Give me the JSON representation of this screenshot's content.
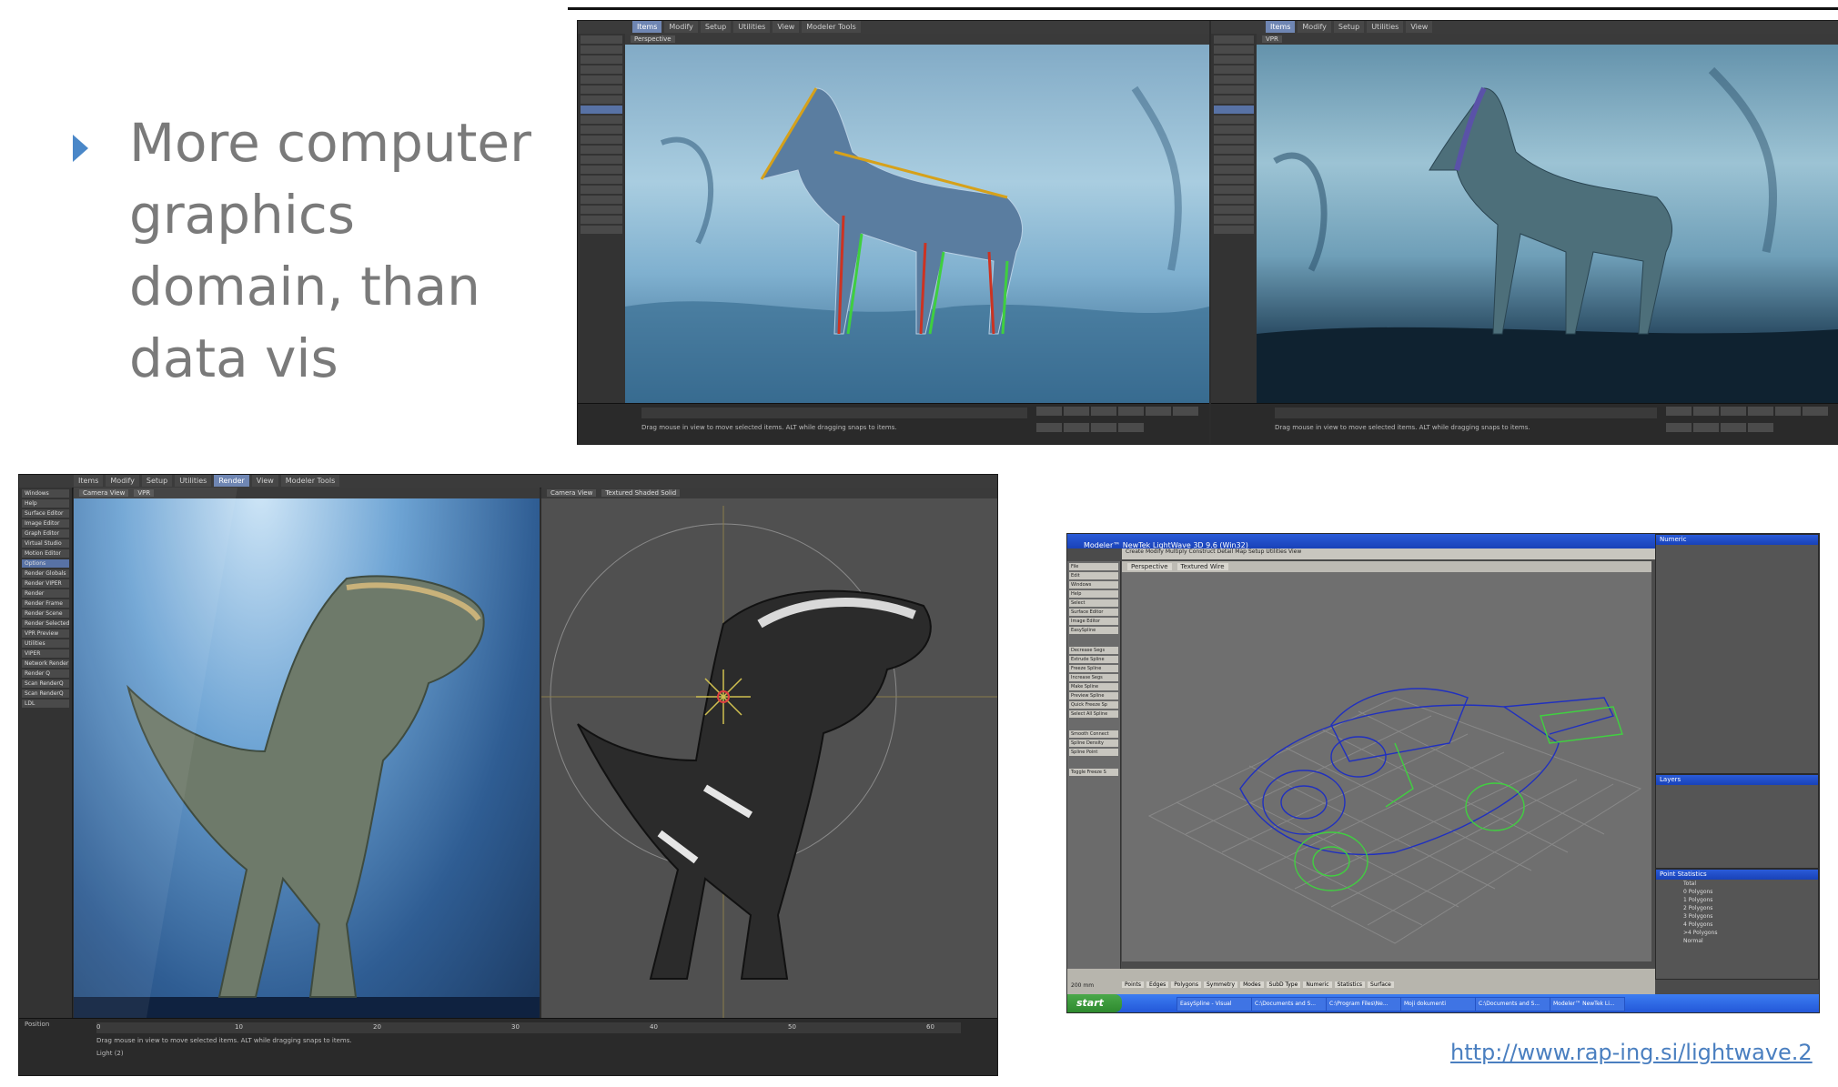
{
  "slide": {
    "bullet_lines": [
      "More computer",
      "graphics",
      "domain, than",
      "data vis"
    ],
    "source_link": "http://www.rap-ing.si/lightwave.2"
  },
  "screenshots": {
    "horse": {
      "menu_tabs": [
        "Items",
        "Modify",
        "Setup",
        "Utilities",
        "View",
        "Modeler Tools"
      ],
      "left_view_label": "Perspective",
      "right_view_label": "VPR",
      "status_text": "Drag mouse in view to move selected items. ALT while dragging snaps to items."
    },
    "trex": {
      "menu_tabs": [
        "Items",
        "Modify",
        "Setup",
        "Utilities",
        "Render",
        "View",
        "Modeler Tools"
      ],
      "left_view_label": "Camera View",
      "left_view_mode": "VPR",
      "right_view_label": "Camera View",
      "right_view_mode": "Textured Shaded Solid",
      "side_buttons": [
        "Windows",
        "Help",
        "Surface Editor",
        "Image Editor",
        "Graph Editor",
        "Virtual Studio",
        "Motion Editor",
        "Options",
        "Render Globals",
        "Render VIPER",
        "Render",
        "Render Frame",
        "Render Scene",
        "Render Selected",
        "VPR Preview",
        "Utilities",
        "VIPER",
        "Network Render",
        "Render Q",
        "Scan RenderQ",
        "Scan RenderQ",
        "LDL"
      ],
      "status_text": "Drag mouse in view to move selected items. ALT while dragging snaps to items.",
      "position_label": "Position",
      "current_item": "Light (2)",
      "frame_ticks": [
        "0",
        "10",
        "20",
        "30",
        "40",
        "50",
        "60"
      ]
    },
    "car": {
      "title": "Modeler™ NewTek LightWave 3D 9.6 (Win32)",
      "menu_tabs": [
        "Create",
        "Modify",
        "Multiply",
        "Construct",
        "Detail",
        "Map",
        "Setup",
        "Utilities",
        "View"
      ],
      "view_label": "Perspective",
      "view_mode": "Textured Wire",
      "right_panels": [
        "Numeric",
        "Layers",
        "Point Statistics"
      ],
      "point_stats": [
        "Total",
        "0 Polygons",
        "1 Polygons",
        "2 Polygons",
        "3 Polygons",
        "4 Polygons",
        ">4 Polygons",
        "Normal"
      ],
      "left_buttons": [
        "File",
        "Edit",
        "Windows",
        "Help",
        "Select",
        "Surface Editor",
        "Image Editor",
        "EasySpline",
        "Decrease Segs",
        "Extrude Spline",
        "Freeze Spline",
        "Increase Segs",
        "Make Spline",
        "Preview Spline",
        "Quick Freeze Sp",
        "Select All Spline",
        "Smooth Connect",
        "Spline Density",
        "Spline Point",
        "Toggle Freeze S"
      ],
      "bottom_fields": [
        "Points",
        "Edges",
        "Polygons",
        "Symmetry",
        "Modes",
        "SubD Type",
        "Numeric",
        "Statistics",
        "Surface"
      ],
      "grid_label": "200 mm",
      "taskbar_start": "start",
      "taskbar_items": [
        "EasySpline - Visual",
        "C:\\Documents and S...",
        "C:\\Program Files\\Ne...",
        "Moji dokumenti",
        "C:\\Documents and S...",
        "Modeler™ NewTek Li..."
      ]
    }
  }
}
